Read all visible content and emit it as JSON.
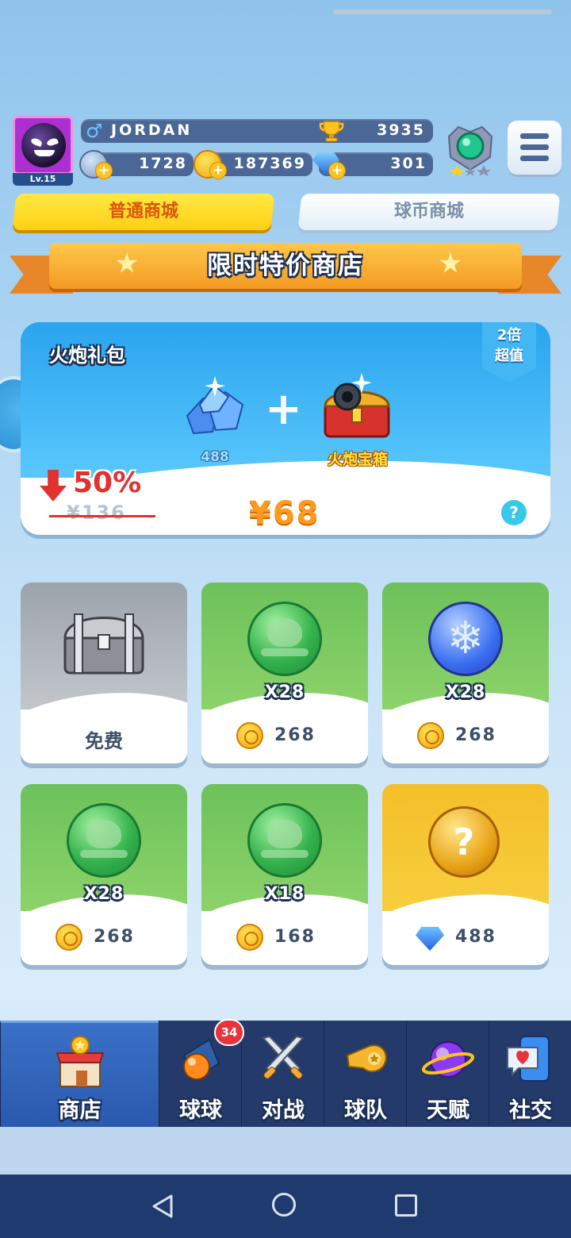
{
  "header": {
    "level": "Lv.15",
    "gender_symbol": "♂",
    "player_name": "JORDAN",
    "trophy_score": "3935",
    "energy": "1728",
    "coins": "187369",
    "diamonds": "301"
  },
  "tabs": [
    {
      "label": "普通商城",
      "active": true
    },
    {
      "label": "球币商城",
      "active": false
    }
  ],
  "banner": {
    "title": "限时特价商店"
  },
  "promo": {
    "title": "火炮礼包",
    "tag_line1": "2倍",
    "tag_line2": "超值",
    "gem_amount": "488",
    "chest_label": "火炮宝箱",
    "discount": "50%",
    "old_price": "¥136",
    "price": "¥68",
    "help": "?"
  },
  "items": [
    {
      "label": "免费"
    },
    {
      "qty": "X28",
      "cost": "268"
    },
    {
      "qty": "X28",
      "cost": "268"
    },
    {
      "qty": "X28",
      "cost": "268"
    },
    {
      "qty": "X18",
      "cost": "168"
    },
    {
      "question": "?",
      "cost": "488"
    }
  ],
  "nav": {
    "items": [
      {
        "label": "商店",
        "active": true
      },
      {
        "label": "球球",
        "badge": "34"
      },
      {
        "label": "对战"
      },
      {
        "label": "球队"
      },
      {
        "label": "天赋"
      },
      {
        "label": "社交"
      }
    ]
  },
  "colors": {
    "accent_yellow": "#ffd21a",
    "price_orange": "#ff9a1d",
    "discount_red": "#e23131",
    "nav_bg": "#233a6b"
  }
}
